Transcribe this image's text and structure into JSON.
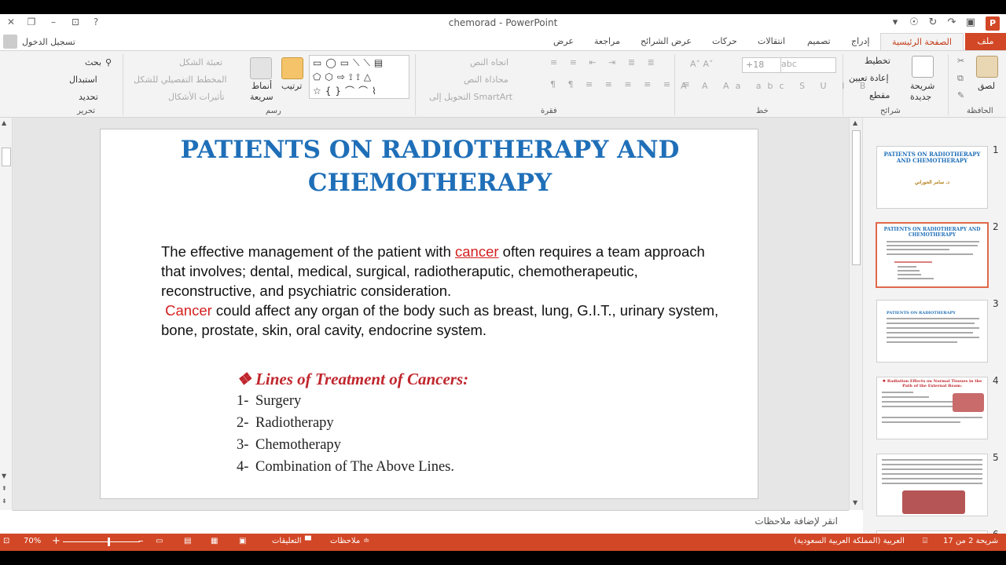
{
  "titlebar": {
    "title": "chemorad - PowerPoint",
    "sign_in": "تسجيل الدخول"
  },
  "tabs": {
    "file": "ملف",
    "home": "الصفحة الرئيسية",
    "insert": "إدراج",
    "design": "تصميم",
    "transitions": "انتقالات",
    "animations": "حركات",
    "slideshow": "عرض الشرائح",
    "review": "مراجعة",
    "view": "عرض"
  },
  "ribbon": {
    "clipboard": {
      "paste": "لصق",
      "label": "الحافظة"
    },
    "slides": {
      "new_slide": "شريحة",
      "new_slide2": "جديدة",
      "layout": "تخطيط",
      "reset": "إعادة تعيين",
      "section": "مقطع",
      "label": "شرائح"
    },
    "font": {
      "size": "+18",
      "label": "خط"
    },
    "paragraph": {
      "text_direction": "اتجاه النص",
      "align_text": "محاذاة النص",
      "smartart": "التحويل إلى SmartArt",
      "label": "فقرة"
    },
    "drawing": {
      "arrange": "ترتيب",
      "quick_styles": "أنماط",
      "quick_styles2": "سريعة",
      "shape_fill": "تعبئة الشكل",
      "shape_outline": "المخطط التفصيلي للشكل",
      "shape_effects": "تأثيرات الأشكال",
      "label": "رسم"
    },
    "editing": {
      "find": "بحث",
      "replace": "استبدال",
      "select": "تحديد",
      "label": "تحرير"
    }
  },
  "slide": {
    "title_line1": "PATIENTS ON RADIOTHERAPY AND",
    "title_line2": "CHEMOTHERAPY",
    "p1_a": "The effective management of the patient with ",
    "p1_cancer": "cancer",
    "p1_b": " often requires a team approach",
    "p1_line2": "that involves; dental, medical, surgical, radiotheraputic, chemotherapeutic,",
    "p1_line3": "reconstructive, and psychiatric consideration.",
    "p2_cancer": "Cancer",
    "p2_a": " could affect any organ of the body such as breast, lung, G.I.T., urinary system,",
    "p2_line2": "bone, prostate, skin, oral cavity, endocrine system.",
    "lines_heading": "❖ Lines of Treatment of Cancers:",
    "treatments": [
      {
        "num": "1-",
        "text": "Surgery"
      },
      {
        "num": "2-",
        "text": "Radiotherapy"
      },
      {
        "num": "3-",
        "text": "Chemotherapy"
      },
      {
        "num": "4-",
        "text": "Combination of The Above Lines."
      }
    ]
  },
  "thumbnails": {
    "items": [
      {
        "num": "1",
        "title": "PATIENTS ON RADIOTHERAPY AND CHEMOTHERAPY",
        "subtitle": "د. سامر الحوراني"
      },
      {
        "num": "2",
        "title": "PATIENTS ON RADIOTHERAPY AND CHEMOTHERAPY"
      },
      {
        "num": "3",
        "title": "PATIENTS ON RADIOTHERAPY"
      },
      {
        "num": "4",
        "title": "❖ Radiation Effects on Normal Tissues in the Path of the External Beam:"
      },
      {
        "num": "5",
        "title": ""
      },
      {
        "num": "6",
        "title": ""
      }
    ]
  },
  "notes": {
    "placeholder": "انقر لإضافة ملاحظات"
  },
  "statusbar": {
    "slide_of": "شريحة 2 من 17",
    "language": "العربية (المملكة العربية السعودية)",
    "notes": "ملاحظات",
    "comments": "التعليقات",
    "zoom": "70%",
    "zoom_level": 0.7
  },
  "colors": {
    "accent": "#d24726",
    "title_blue": "#1f6fb8",
    "red_text": "#d41f1f"
  }
}
